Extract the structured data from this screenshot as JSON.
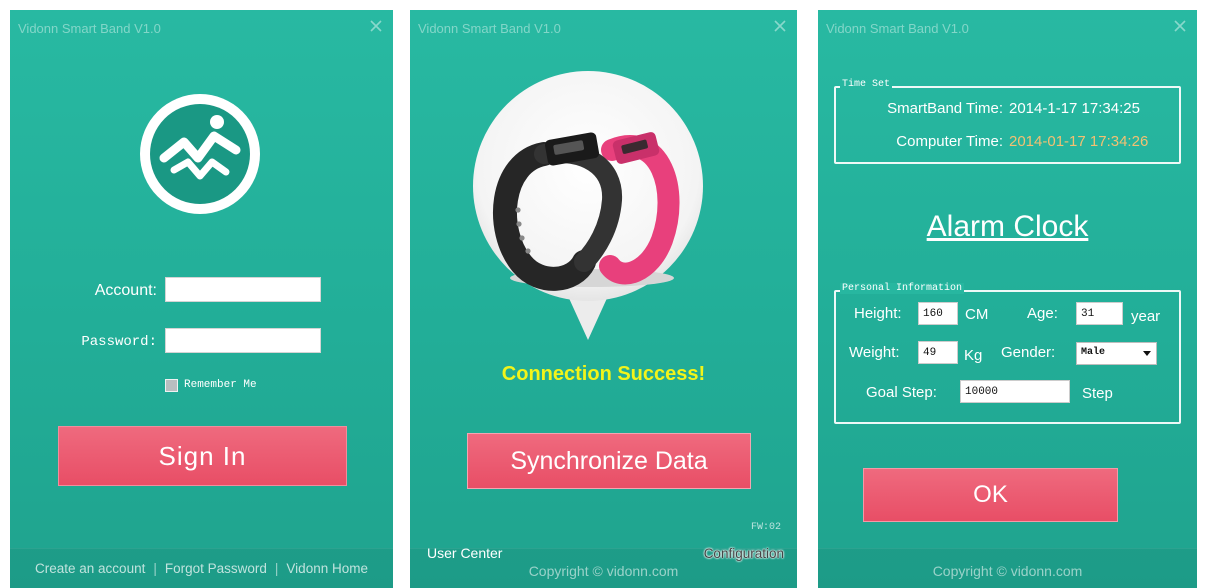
{
  "app": {
    "title": "Vidonn Smart Band V1.0"
  },
  "login": {
    "account_label": "Account:",
    "account_value": "",
    "password_label": "Password:",
    "password_value": "",
    "remember_label": "Remember Me",
    "remember_checked": false,
    "signin_label": "Sign In",
    "links": [
      "Create an account",
      "Forgot Password",
      "Vidonn Home"
    ],
    "separator": "|"
  },
  "sync": {
    "status": "Connection Success!",
    "sync_button": "Synchronize Data",
    "firmware": "FW:02",
    "user_center": "User Center",
    "copyright": "Copyright © vidonn.com",
    "configuration": "Configuration"
  },
  "settings": {
    "time_set_title": "Time Set",
    "smartband_time_label": "SmartBand Time:",
    "smartband_time_value": "2014-1-17 17:34:25",
    "computer_time_label": "Computer Time:",
    "computer_time_value": "2014-01-17 17:34:26",
    "alarm_clock": "Alarm Clock",
    "personal_title": "Personal Information",
    "height_label": "Height:",
    "height_value": "160",
    "height_unit": "CM",
    "age_label": "Age:",
    "age_value": "31",
    "age_unit": "year",
    "weight_label": "Weight:",
    "weight_value": "49",
    "weight_unit": "Kg",
    "gender_label": "Gender:",
    "gender_value": "Male",
    "goal_label": "Goal Step:",
    "goal_value": "10000",
    "goal_unit": "Step",
    "ok_label": "OK",
    "copyright": "Copyright © vidonn.com"
  },
  "colors": {
    "window_bg": "#25b49e",
    "button_pink": "#ea5a70",
    "status_yellow": "#f2f41a",
    "computer_time_orange": "#f3c072",
    "time_white": "#ffffff"
  },
  "icons": {
    "close": "close-icon",
    "logo": "vidonn-logo-icon",
    "dropdown": "chevron-down-icon"
  }
}
